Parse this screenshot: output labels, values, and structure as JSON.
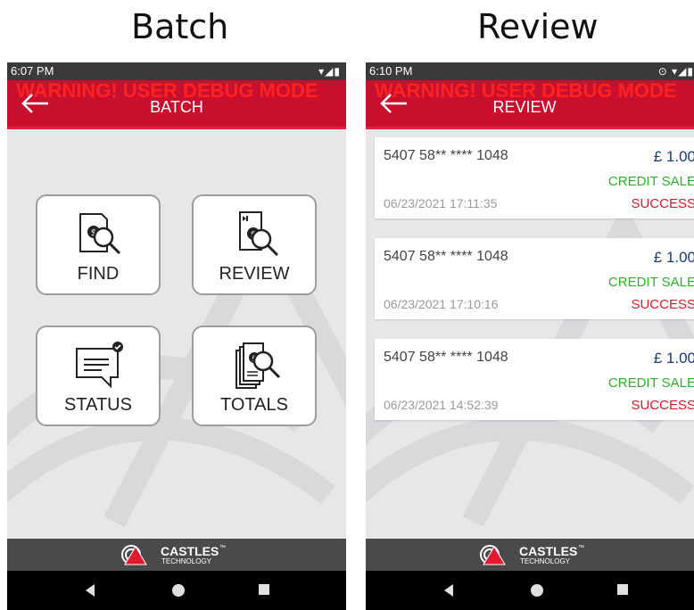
{
  "captions": {
    "left": "Batch",
    "right": "Review"
  },
  "colors": {
    "appbar": "#c8102e",
    "warning": "#ff2020",
    "amount": "#1b3c6e",
    "type": "#2eae2e",
    "result": "#e0162b"
  },
  "batch_screen": {
    "status_time": "6:07 PM",
    "warning": "WARNING! USER DEBUG MODE",
    "title": "BATCH",
    "tiles": [
      {
        "label": "FIND",
        "icon": "find-icon"
      },
      {
        "label": "REVIEW",
        "icon": "review-icon"
      },
      {
        "label": "STATUS",
        "icon": "status-icon"
      },
      {
        "label": "TOTALS",
        "icon": "totals-icon"
      }
    ],
    "footer": {
      "brand": "CASTLES",
      "tm": "™",
      "sub": "TECHNOLOGY"
    }
  },
  "review_screen": {
    "status_time": "6:10 PM",
    "warning": "WARNING! USER DEBUG MODE",
    "title": "REVIEW",
    "transactions": [
      {
        "card": "5407 58** **** 1048",
        "amount": "£ 1.00",
        "type": "CREDIT SALE",
        "datetime": "06/23/2021 17:11:35",
        "result": "SUCCESS"
      },
      {
        "card": "5407 58** **** 1048",
        "amount": "£ 1.00",
        "type": "CREDIT SALE",
        "datetime": "06/23/2021 17:10:16",
        "result": "SUCCESS"
      },
      {
        "card": "5407 58** **** 1048",
        "amount": "£ 1.00",
        "type": "CREDIT SALE",
        "datetime": "06/23/2021 14:52:39",
        "result": "SUCCESS"
      }
    ],
    "footer": {
      "brand": "CASTLES",
      "tm": "™",
      "sub": "TECHNOLOGY"
    }
  }
}
